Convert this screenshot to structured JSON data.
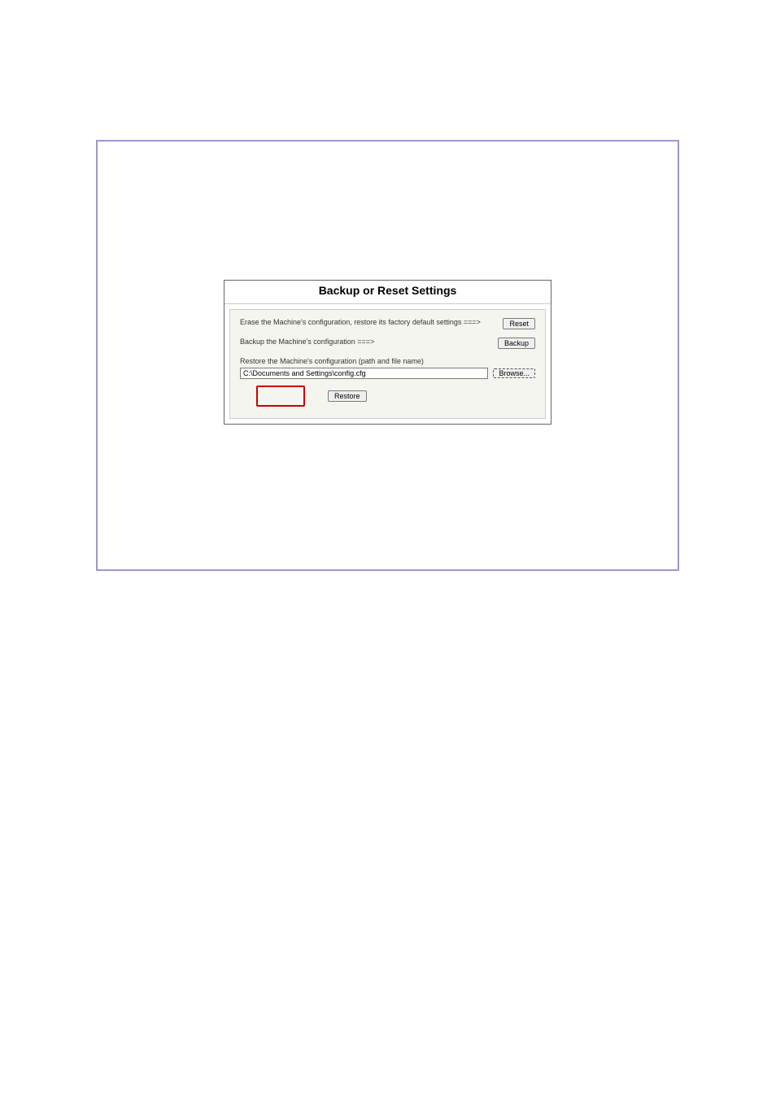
{
  "panel": {
    "title": "Backup or Reset Settings",
    "reset_text": "Erase the Machine's configuration, restore its factory default settings ===>",
    "reset_btn": "Reset",
    "backup_text": "Backup the Machine's configuration ===>",
    "backup_btn": "Backup",
    "restore_text": "Restore the Machine's configuration (path and file name)",
    "path_value": "C:\\Documents and Settings\\config.cfg",
    "browse_btn": "Browse...",
    "restore_btn": "Restore"
  }
}
